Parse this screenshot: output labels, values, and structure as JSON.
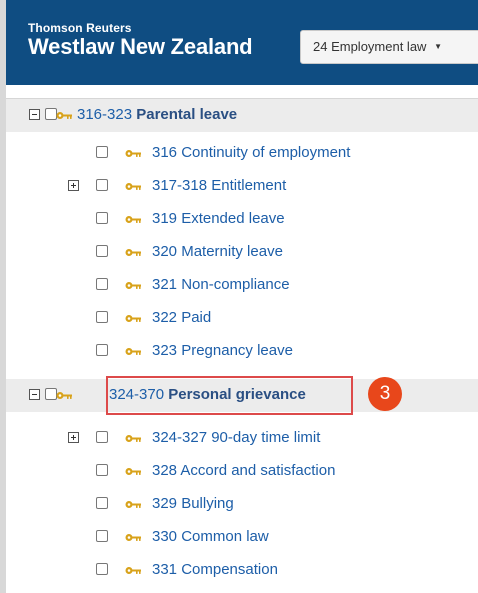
{
  "header": {
    "brand_top": "Thomson Reuters",
    "brand_main": "Westlaw New Zealand",
    "dropdown_label": "24 Employment law",
    "dropdown_caret": "▼"
  },
  "tree": {
    "parental": {
      "range": "316-323",
      "title": "Parental leave",
      "children": [
        {
          "label": "316 Continuity of employment"
        },
        {
          "label": "317-318 Entitlement"
        },
        {
          "label": "319 Extended leave"
        },
        {
          "label": "320 Maternity leave"
        },
        {
          "label": "321 Non-compliance"
        },
        {
          "label": "322 Paid"
        },
        {
          "label": "323 Pregnancy leave"
        }
      ]
    },
    "personal": {
      "range": "324-370",
      "title": "Personal grievance",
      "children": [
        {
          "label": "324-327 90-day time limit"
        },
        {
          "label": "328 Accord and satisfaction"
        },
        {
          "label": "329 Bullying"
        },
        {
          "label": "330 Common law"
        },
        {
          "label": "331 Compensation"
        }
      ]
    }
  },
  "annotation": {
    "step": "3",
    "color": "#e8471b"
  },
  "colors": {
    "header": "#0f4d82",
    "link": "#1d5ea8",
    "key": "#d8a21a"
  }
}
